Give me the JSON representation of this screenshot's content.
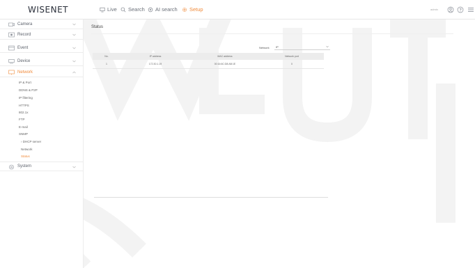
{
  "app": {
    "logo_main": "WISE",
    "logo_tail": "NET"
  },
  "topnav": {
    "live": "Live",
    "search": "Search",
    "ai_search": "AI search",
    "setup": "Setup",
    "user": "admin"
  },
  "sidebar": {
    "sections": [
      {
        "label": "Camera",
        "icon": "camera-icon"
      },
      {
        "label": "Record",
        "icon": "record-icon"
      },
      {
        "label": "Event",
        "icon": "event-icon"
      },
      {
        "label": "Device",
        "icon": "device-icon"
      },
      {
        "label": "Network",
        "icon": "network-icon"
      }
    ],
    "network_items": [
      "IP & Port",
      "DDNS & P2P",
      "IP filtering",
      "HTTPS",
      "802.1x",
      "FTP",
      "E-mail",
      "SNMP",
      "DHCP server",
      "Network",
      "Status"
    ],
    "system": {
      "label": "System",
      "icon": "system-icon"
    }
  },
  "page": {
    "title": "Status",
    "network_label": "Network",
    "network_value": "IP"
  },
  "table": {
    "headers": [
      "No.",
      "IP address",
      "MAC address",
      "Network port"
    ],
    "rows": [
      [
        "1",
        "172.30.1.19",
        "00:16:6C:D8:AB:1E",
        "0"
      ]
    ]
  },
  "colors": {
    "accent": "#f08a3a"
  }
}
